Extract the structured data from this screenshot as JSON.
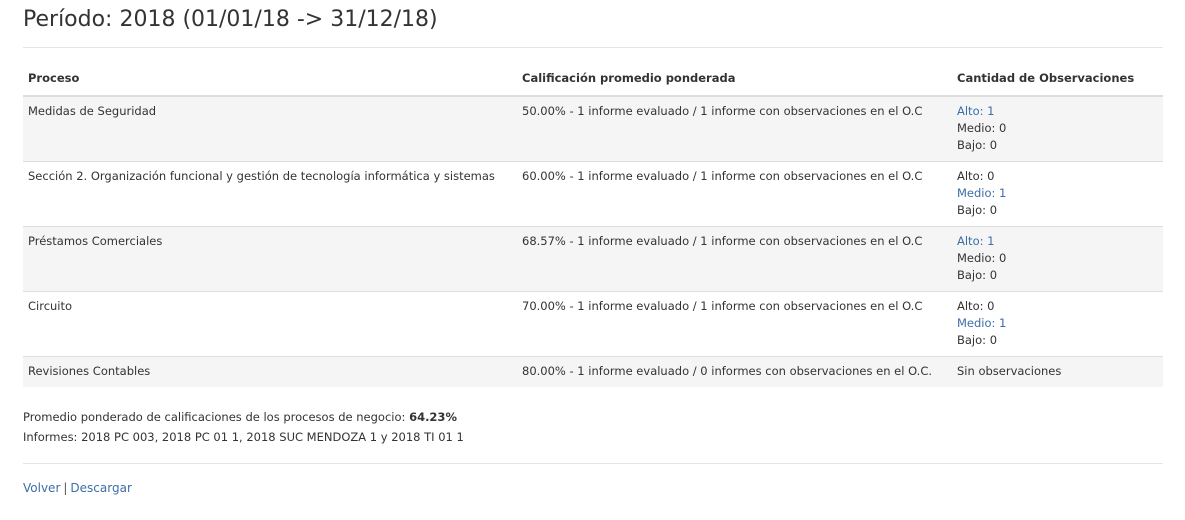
{
  "header": {
    "title": "Período: 2018 (01/01/18 -> 31/12/18)"
  },
  "table": {
    "columns": [
      "Proceso",
      "Calificación promedio ponderada",
      "Cantidad de Observaciones"
    ],
    "rows": [
      {
        "proceso": "Medidas de Seguridad",
        "calificacion": "50.00% - 1 informe evaluado / 1 informe con observaciones en el O.C",
        "observaciones": [
          {
            "text": "Alto: 1",
            "link": true
          },
          {
            "text": "Medio: 0",
            "link": false
          },
          {
            "text": "Bajo: 0",
            "link": false
          }
        ]
      },
      {
        "proceso": "Sección 2. Organización funcional y gestión de tecnología informática y sistemas",
        "calificacion": "60.00% - 1 informe evaluado / 1 informe con observaciones en el O.C",
        "observaciones": [
          {
            "text": "Alto: 0",
            "link": false
          },
          {
            "text": "Medio: 1",
            "link": true
          },
          {
            "text": "Bajo: 0",
            "link": false
          }
        ]
      },
      {
        "proceso": "Préstamos Comerciales",
        "calificacion": "68.57% - 1 informe evaluado / 1 informe con observaciones en el O.C",
        "observaciones": [
          {
            "text": "Alto: 1",
            "link": true
          },
          {
            "text": "Medio: 0",
            "link": false
          },
          {
            "text": "Bajo: 0",
            "link": false
          }
        ]
      },
      {
        "proceso": "Circuito",
        "calificacion": "70.00% - 1 informe evaluado / 1 informe con observaciones en el O.C",
        "observaciones": [
          {
            "text": "Alto: 0",
            "link": false
          },
          {
            "text": "Medio: 1",
            "link": true
          },
          {
            "text": "Bajo: 0",
            "link": false
          }
        ]
      },
      {
        "proceso": "Revisiones Contables",
        "calificacion": "80.00% - 1 informe evaluado / 0 informes con observaciones en el O.C.",
        "observaciones": [
          {
            "text": "Sin observaciones",
            "link": false
          }
        ]
      }
    ]
  },
  "summary": {
    "promedio_label": "Promedio ponderado de calificaciones de los procesos de negocio: ",
    "promedio_value": "64.23%",
    "informes": "Informes: 2018 PC 003, 2018 PC 01 1, 2018 SUC MENDOZA 1 y 2018 TI 01 1"
  },
  "footer": {
    "volver": "Volver",
    "separator": "|",
    "descargar": "Descargar"
  }
}
